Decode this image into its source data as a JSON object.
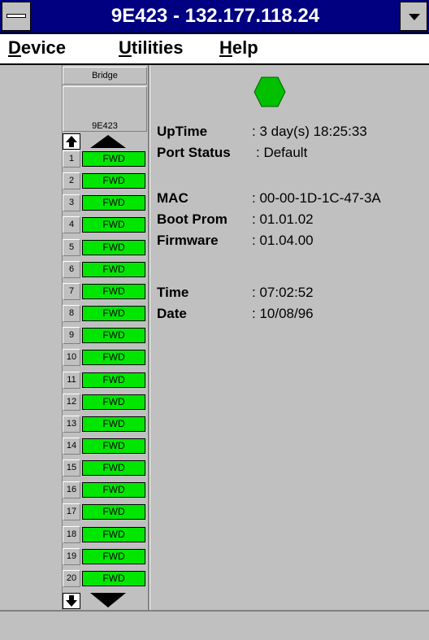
{
  "title": "9E423 - 132.177.118.24",
  "menu": {
    "device": "Device",
    "utilities": "Utilities",
    "help": "Help"
  },
  "bridge_header": "Bridge",
  "device_name": "9E423",
  "status_indicator_color": "#00c000",
  "ports": [
    {
      "num": "1",
      "status": "FWD"
    },
    {
      "num": "2",
      "status": "FWD"
    },
    {
      "num": "3",
      "status": "FWD"
    },
    {
      "num": "4",
      "status": "FWD"
    },
    {
      "num": "5",
      "status": "FWD"
    },
    {
      "num": "6",
      "status": "FWD"
    },
    {
      "num": "7",
      "status": "FWD"
    },
    {
      "num": "8",
      "status": "FWD"
    },
    {
      "num": "9",
      "status": "FWD"
    },
    {
      "num": "10",
      "status": "FWD"
    },
    {
      "num": "11",
      "status": "FWD"
    },
    {
      "num": "12",
      "status": "FWD"
    },
    {
      "num": "13",
      "status": "FWD"
    },
    {
      "num": "14",
      "status": "FWD"
    },
    {
      "num": "15",
      "status": "FWD"
    },
    {
      "num": "16",
      "status": "FWD"
    },
    {
      "num": "17",
      "status": "FWD"
    },
    {
      "num": "18",
      "status": "FWD"
    },
    {
      "num": "19",
      "status": "FWD"
    },
    {
      "num": "20",
      "status": "FWD"
    }
  ],
  "info": {
    "uptime_label": "UpTime",
    "uptime_value": ": 3 day(s) 18:25:33",
    "portstatus_label": "Port Status",
    "portstatus_value": ": Default",
    "mac_label": "MAC",
    "mac_value": ": 00-00-1D-1C-47-3A",
    "bootprom_label": "Boot Prom",
    "bootprom_value": ": 01.01.02",
    "firmware_label": "Firmware",
    "firmware_value": ": 01.04.00",
    "time_label": "Time",
    "time_value": ": 07:02:52",
    "date_label": "Date",
    "date_value": ": 10/08/96"
  }
}
